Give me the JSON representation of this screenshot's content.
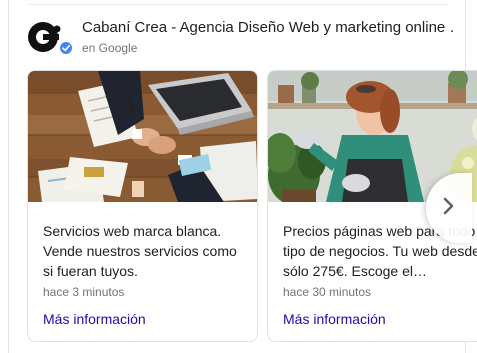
{
  "header": {
    "business_name": "Cabaní Crea - Agencia Diseño Web y marketing online …",
    "source": "en Google",
    "logo_icon": "cabani-crea-logo-icon",
    "verified_icon": "verified-check-icon"
  },
  "posts": [
    {
      "image": "business-handshake-laptop-photo",
      "text": "Servicios web marca blanca. Vende nuestros servicios como si fueran tuyos.",
      "time": "hace 3 minutos",
      "link": "Más información"
    },
    {
      "image": "woman-florist-plants-photo",
      "text": "Precios páginas web para todo tipo de negocios. Tu web desde sólo 275€. Escoge el…",
      "time": "hace 30 minutos",
      "link": "Más información"
    }
  ],
  "carousel": {
    "next_icon": "chevron-right-icon"
  },
  "colors": {
    "link": "#1a0dab",
    "secondary_text": "#70757a",
    "verified": "#4285f4"
  }
}
